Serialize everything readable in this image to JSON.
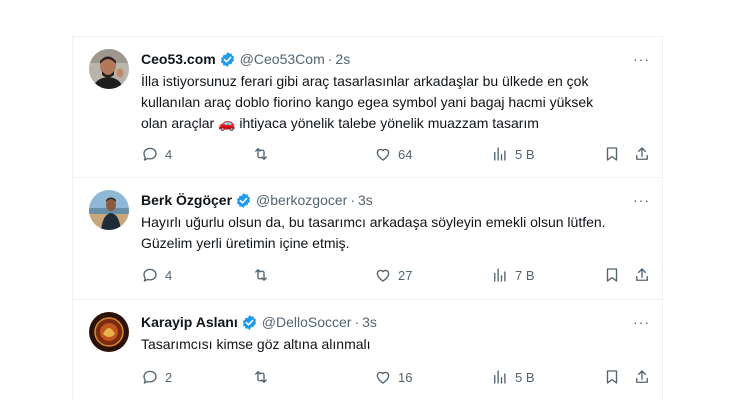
{
  "tweets": [
    {
      "name": "Ceo53.com",
      "handle": "@Ceo53Com",
      "time": "2s",
      "lines": [
        "İlla istiyorsunuz ferari gibi araç tasarlasınlar arkadaşlar bu ülkede en çok",
        "kullanılan araç doblo fiorino kango egea symbol yani bagaj hacmi yüksek",
        "olan araçlar 🚗 ihtiyaca yönelik talebe yönelik muazzam tasarım"
      ],
      "replies": "4",
      "retweets": "",
      "likes": "64",
      "views": "5 B"
    },
    {
      "name": "Berk Özgöçer",
      "handle": "@berkozgocer",
      "time": "3s",
      "lines": [
        "Hayırlı uğurlu olsun da, bu tasarımcı arkadaşa söyleyin emekli olsun lütfen.",
        "Güzelim yerli üretimin içine etmiş."
      ],
      "replies": "4",
      "retweets": "",
      "likes": "27",
      "views": "7 B"
    },
    {
      "name": "Karayip Aslanı",
      "handle": "@DelloSoccer",
      "time": "3s",
      "lines": [
        "Tasarımcısı kimse göz altına alınmalı"
      ],
      "replies": "2",
      "retweets": "",
      "likes": "16",
      "views": "5 B"
    }
  ],
  "separator": "·",
  "more_glyph": "···",
  "colors": {
    "verified": "#1d9bf0",
    "secondary": "#536471",
    "border": "#eff3f4"
  },
  "icons": [
    "reply-icon",
    "retweet-icon",
    "like-icon",
    "views-icon",
    "bookmark-icon",
    "share-icon",
    "more-icon",
    "verified-icon"
  ]
}
